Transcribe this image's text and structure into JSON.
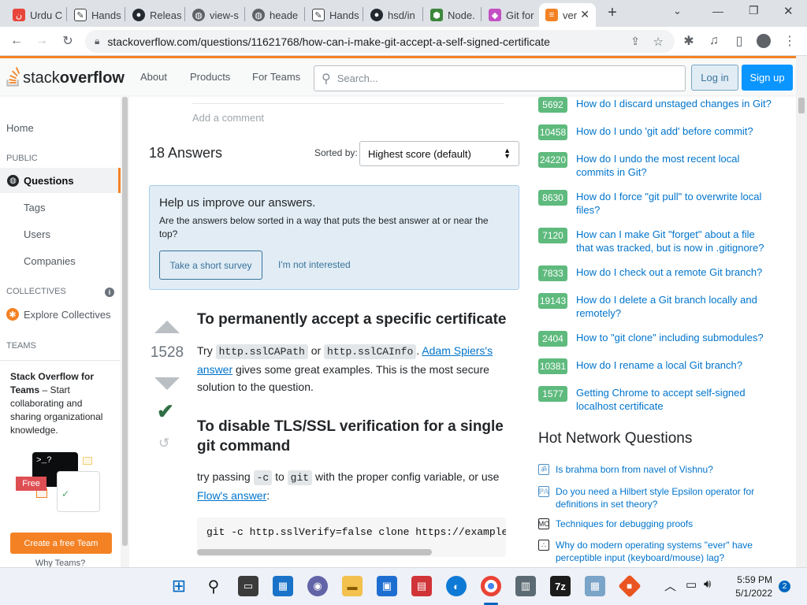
{
  "browser": {
    "tabs": [
      {
        "title": "Urdu C",
        "favicon": "#e8453c"
      },
      {
        "title": "Hands",
        "favicon": "#3c4043"
      },
      {
        "title": "Releas",
        "favicon": "#24292f"
      },
      {
        "title": "view-s",
        "favicon": "#5f6368"
      },
      {
        "title": "heade",
        "favicon": "#5f6368"
      },
      {
        "title": "Hands",
        "favicon": "#3c4043"
      },
      {
        "title": "hsd/in",
        "favicon": "#24292f"
      },
      {
        "title": "Node.",
        "favicon": "#3c873a"
      },
      {
        "title": "Git for",
        "favicon": "#c44fc5"
      },
      {
        "title": "ver",
        "favicon": "#f48225"
      }
    ],
    "new_tab": "+",
    "url": "stackoverflow.com/questions/11621768/how-can-i-make-git-accept-a-self-signed-certificate"
  },
  "header": {
    "logo_stack": "stack",
    "logo_overflow": "overflow",
    "nav": [
      "About",
      "Products",
      "For Teams"
    ],
    "search_placeholder": "Search...",
    "login": "Log in",
    "signup": "Sign up"
  },
  "sidebar": {
    "home": "Home",
    "public_label": "PUBLIC",
    "questions": "Questions",
    "tags": "Tags",
    "users": "Users",
    "companies": "Companies",
    "collectives_label": "COLLECTIVES",
    "explore_collectives": "Explore Collectives",
    "teams_label": "TEAMS",
    "teams_title": "Stack Overflow for Teams",
    "teams_body": " – Start collaborating and sharing organizational knowledge.",
    "free_badge": "Free",
    "create_team": "Create a free Team",
    "why_teams": "Why Teams?"
  },
  "main": {
    "add_comment": "Add a comment",
    "answers_count": "18 Answers",
    "sorted_by": "Sorted by:",
    "sort_value": "Highest score (default)",
    "survey": {
      "title": "Help us improve our answers.",
      "body": "Are the answers below sorted in a way that puts the best answer at or near the top?",
      "take_survey": "Take a short survey",
      "not_interested": "I'm not interested"
    },
    "answer": {
      "score": "1528",
      "h1": "To permanently accept a specific certificate",
      "p1_try": "Try ",
      "p1_code1": "http.sslCAPath",
      "p1_or": " or ",
      "p1_code2": "http.sslCAInfo",
      "p1_dot": ". ",
      "p1_link": "Adam Spiers's answer",
      "p1_rest": " gives some great examples. This is the most secure solution to the question.",
      "h2": "To disable TLS/SSL verification for a single git command",
      "p2_a": "try passing ",
      "p2_code1": "-c",
      "p2_to": " to ",
      "p2_code2": "git",
      "p2_b": " with the proper config variable, or use ",
      "p2_link": "Flow's answer",
      "p2_colon": ":",
      "codeblock": "git -c http.sslVerify=false clone https://example."
    }
  },
  "linked_questions": [
    {
      "score": "5692",
      "title": "How do I discard unstaged changes in Git?"
    },
    {
      "score": "10458",
      "title": "How do I undo 'git add' before commit?"
    },
    {
      "score": "24220",
      "title": "How do I undo the most recent local commits in Git?"
    },
    {
      "score": "8630",
      "title": "How do I force \"git pull\" to overwrite local files?"
    },
    {
      "score": "7120",
      "title": "How can I make Git \"forget\" about a file that was tracked, but is now in .gitignore?"
    },
    {
      "score": "7833",
      "title": "How do I check out a remote Git branch?"
    },
    {
      "score": "19143",
      "title": "How do I delete a Git branch locally and remotely?"
    },
    {
      "score": "2404",
      "title": "How to \"git clone\" including submodules?"
    },
    {
      "score": "10381",
      "title": "How do I rename a local Git branch?"
    },
    {
      "score": "1577",
      "title": "Getting Chrome to accept self-signed localhost certificate"
    }
  ],
  "hot_network": {
    "title": "Hot Network Questions",
    "items": [
      {
        "text": "Is brahma born from navel of Vishnu?",
        "icon": "#4a90c8"
      },
      {
        "text": "Do you need a Hilbert style Epsilon operator for definitions in set theory?",
        "icon": "#4a90c8"
      },
      {
        "text": "Techniques for debugging proofs",
        "icon": "#232629"
      },
      {
        "text": "Why do modern operating systems \"ever\" have perceptible input (keyboard/mouse) lag?",
        "icon": "#232629"
      }
    ]
  },
  "taskbar": {
    "time": "5:59 PM",
    "date": "5/1/2022",
    "notifications": "2"
  },
  "colors": {
    "accent": "#f48225",
    "link": "#0074cc",
    "accepted": "#2f6f44",
    "score_badge": "#5eba7d",
    "primary_btn": "#0a95ff"
  }
}
